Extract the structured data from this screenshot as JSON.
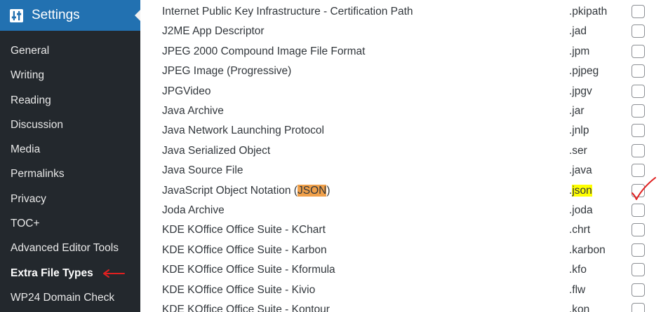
{
  "sidebar": {
    "title": "Settings",
    "items": [
      {
        "label": "General"
      },
      {
        "label": "Writing"
      },
      {
        "label": "Reading"
      },
      {
        "label": "Discussion"
      },
      {
        "label": "Media"
      },
      {
        "label": "Permalinks"
      },
      {
        "label": "Privacy"
      },
      {
        "label": "TOC+"
      },
      {
        "label": "Advanced Editor Tools"
      },
      {
        "label": "Extra File Types"
      },
      {
        "label": "WP24 Domain Check"
      }
    ],
    "current_item": "Extra File Types",
    "accent_color": "#2271b1",
    "background_color": "#23282d"
  },
  "file_types": [
    {
      "name": "Internet Public Key Infrastructure - Certification Path",
      "ext": ".pkipath",
      "checked": false
    },
    {
      "name": "J2ME App Descriptor",
      "ext": ".jad",
      "checked": false
    },
    {
      "name": "JPEG 2000 Compound Image File Format",
      "ext": ".jpm",
      "checked": false
    },
    {
      "name": "JPEG Image (Progressive)",
      "ext": ".pjpeg",
      "checked": false
    },
    {
      "name": "JPGVideo",
      "ext": ".jpgv",
      "checked": false
    },
    {
      "name": "Java Archive",
      "ext": ".jar",
      "checked": false
    },
    {
      "name": "Java Network Launching Protocol",
      "ext": ".jnlp",
      "checked": false
    },
    {
      "name": "Java Serialized Object",
      "ext": ".ser",
      "checked": false
    },
    {
      "name": "Java Source File",
      "ext": ".java",
      "checked": false
    },
    {
      "name_prefix": "JavaScript Object Notation (",
      "name_highlight": "JSON",
      "name_suffix": ")",
      "ext_dot": ".",
      "ext_highlight": "json",
      "checked": true
    },
    {
      "name": "Joda Archive",
      "ext": ".joda",
      "checked": false
    },
    {
      "name": "KDE KOffice Office Suite - KChart",
      "ext": ".chrt",
      "checked": false
    },
    {
      "name": "KDE KOffice Office Suite - Karbon",
      "ext": ".karbon",
      "checked": false
    },
    {
      "name": "KDE KOffice Office Suite - Kformula",
      "ext": ".kfo",
      "checked": false
    },
    {
      "name": "KDE KOffice Office Suite - Kivio",
      "ext": ".flw",
      "checked": false
    },
    {
      "name": "KDE KOffice Office Suite - Kontour",
      "ext": ".kon",
      "checked": false
    }
  ],
  "highlight_colors": {
    "name": "#f0a04a",
    "ext": "#ffff00",
    "annotation": "#e02020"
  }
}
